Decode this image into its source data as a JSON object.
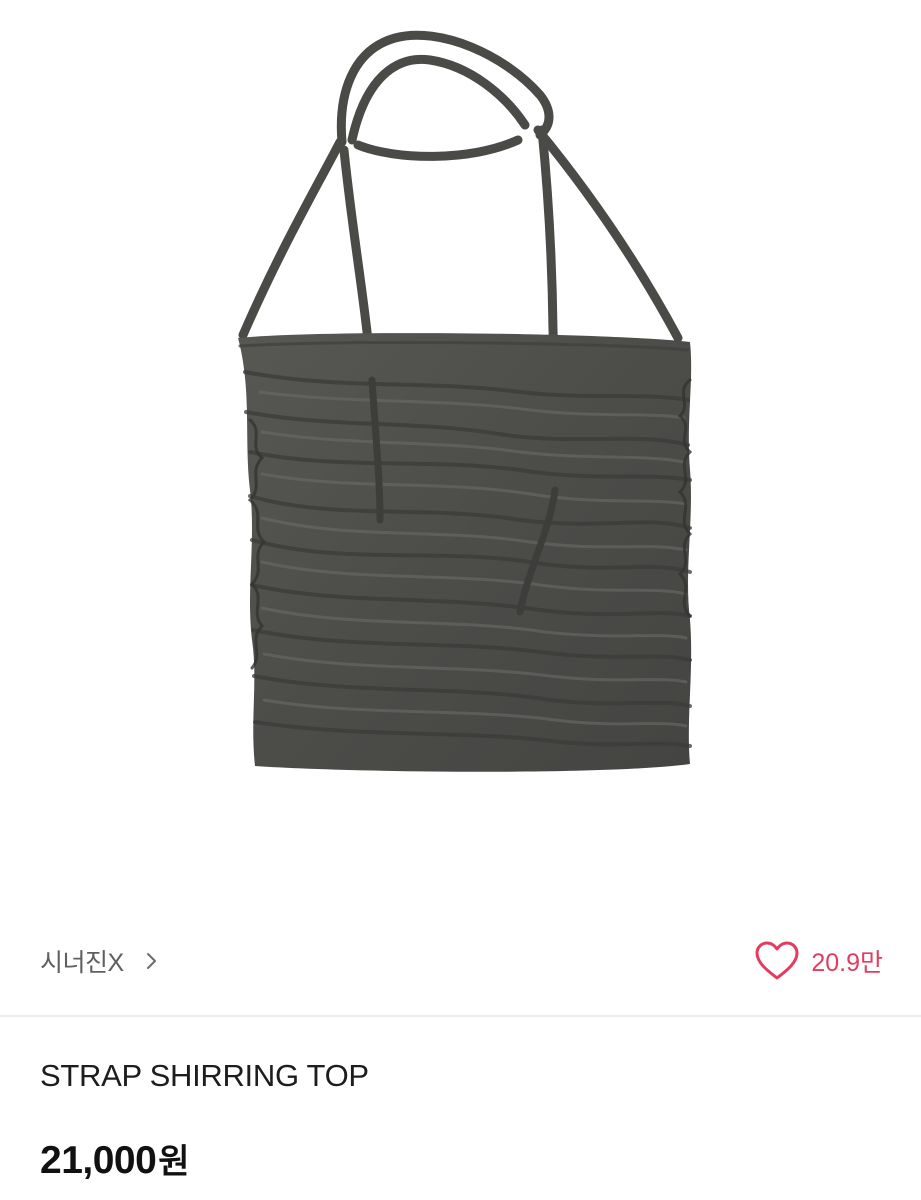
{
  "product": {
    "brand": "시너진X",
    "likes": "20.9만",
    "name": "STRAP SHIRRING TOP",
    "price": "21,000",
    "currency": "원"
  },
  "icons": {
    "brand_chevron": "chevron-right-icon",
    "like": "heart-outline-icon"
  },
  "colors": {
    "like_accent": "#e23d5e",
    "garment": "#4e4e4b",
    "text_primary": "#111111",
    "text_secondary": "#5f5f5f",
    "divider": "#ededed"
  }
}
